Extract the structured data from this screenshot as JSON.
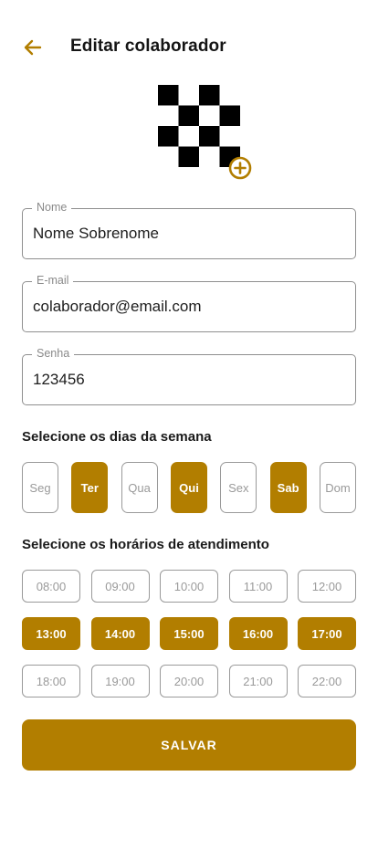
{
  "header": {
    "title": "Editar colaborador"
  },
  "form": {
    "name": {
      "label": "Nome",
      "value": "Nome Sobrenome"
    },
    "email": {
      "label": "E-mail",
      "value": "colaborador@email.com"
    },
    "password": {
      "label": "Senha",
      "value": "123456"
    }
  },
  "days": {
    "title": "Selecione os dias da semana",
    "items": [
      {
        "label": "Seg",
        "selected": false
      },
      {
        "label": "Ter",
        "selected": true
      },
      {
        "label": "Qua",
        "selected": false
      },
      {
        "label": "Qui",
        "selected": true
      },
      {
        "label": "Sex",
        "selected": false
      },
      {
        "label": "Sab",
        "selected": true
      },
      {
        "label": "Dom",
        "selected": false
      }
    ]
  },
  "hours": {
    "title": "Selecione os horários de atendimento",
    "items": [
      {
        "label": "08:00",
        "selected": false
      },
      {
        "label": "09:00",
        "selected": false
      },
      {
        "label": "10:00",
        "selected": false
      },
      {
        "label": "11:00",
        "selected": false
      },
      {
        "label": "12:00",
        "selected": false
      },
      {
        "label": "13:00",
        "selected": true
      },
      {
        "label": "14:00",
        "selected": true
      },
      {
        "label": "15:00",
        "selected": true
      },
      {
        "label": "16:00",
        "selected": true
      },
      {
        "label": "17:00",
        "selected": true
      },
      {
        "label": "18:00",
        "selected": false
      },
      {
        "label": "19:00",
        "selected": false
      },
      {
        "label": "20:00",
        "selected": false
      },
      {
        "label": "21:00",
        "selected": false
      },
      {
        "label": "22:00",
        "selected": false
      }
    ]
  },
  "actions": {
    "save_label": "SALVAR"
  },
  "colors": {
    "accent": "#b27e00",
    "border": "#9a9a9a",
    "text": "#1a1a1a"
  },
  "icons": {
    "back": "arrow-left-icon",
    "avatar_add": "plus-circle-icon"
  }
}
